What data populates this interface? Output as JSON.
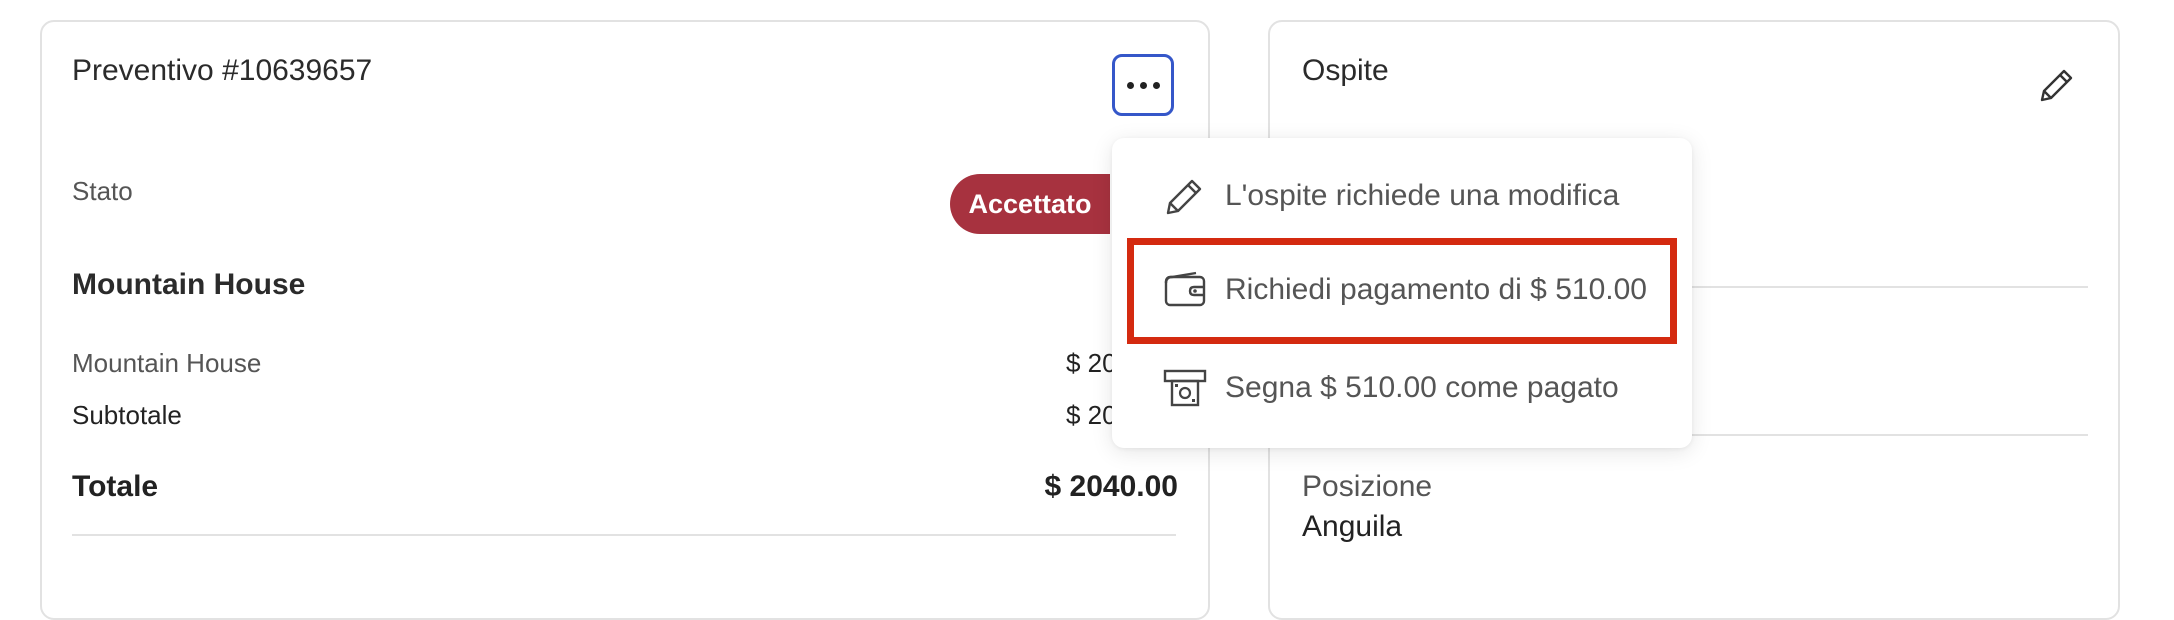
{
  "quote": {
    "title": "Preventivo #10639657",
    "status_label": "Stato",
    "status_value": "Accettato",
    "section_title": "Mountain House",
    "rows": [
      {
        "label": "Mountain House",
        "value": "$ 20"
      },
      {
        "label": "Subtotale",
        "value": "$ 20"
      }
    ],
    "total_label": "Totale",
    "total_value": "$ 2040.00"
  },
  "guest": {
    "title": "Ospite",
    "position_label": "Posizione",
    "position_value": "Anguila"
  },
  "menu": {
    "items": [
      {
        "label": "L'ospite richiede una modifica",
        "icon": "pencil-icon"
      },
      {
        "label": "Richiedi pagamento di $ 510.00",
        "icon": "wallet-icon"
      },
      {
        "label": "Segna $ 510.00 come pagato",
        "icon": "cash-icon"
      }
    ]
  },
  "colors": {
    "status_badge": "#a7323f",
    "focus_ring": "#3557c9",
    "highlight": "#d42a10"
  }
}
